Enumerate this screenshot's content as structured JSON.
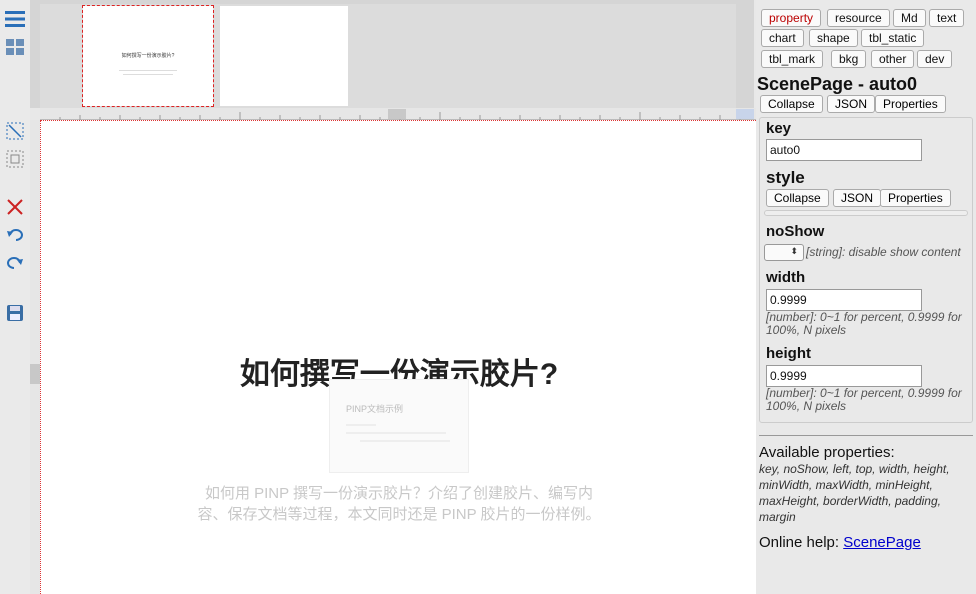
{
  "app": {
    "tabs": [
      "property",
      "resource",
      "Md",
      "text",
      "chart",
      "shape",
      "tbl_static",
      "tbl_mark",
      "bkg",
      "other",
      "dev"
    ]
  },
  "slide": {
    "title": "如何撰写一份演示胶片?",
    "description": "如何用 PINP 撰写一份演示胶片？介绍了创建胶片、编写内容、保存文档等过程，本文同时还是 PINP 胶片的一份样例。",
    "image_caption": "PINP文档示例",
    "thumb_title": "如何撰写一份演示胶片?"
  },
  "panel": {
    "title": "ScenePage - auto0",
    "collapse_label": "Collapse",
    "json_label": "JSON",
    "properties_label": "Properties",
    "key": {
      "label": "key",
      "value": "auto0"
    },
    "style": {
      "label": "style",
      "collapse_label": "Collapse",
      "json_label": "JSON",
      "properties_label": "Properties"
    },
    "noShow": {
      "label": "noShow",
      "hint": "[string]: disable show content"
    },
    "width": {
      "label": "width",
      "value": "0.9999",
      "hint": "[number]: 0~1 for percent, 0.9999 for 100%, N pixels"
    },
    "height": {
      "label": "height",
      "value": "0.9999",
      "hint": "[number]: 0~1 for percent, 0.9999 for 100%, N pixels"
    },
    "available_title": "Available properties:",
    "available_list": "key, noShow, left, top, width, height, minWidth, maxWidth, minHeight, maxHeight, borderWidth, padding, margin",
    "help_prefix": "Online help: ",
    "help_link": "ScenePage"
  },
  "colors": {
    "accent": "#2a6fb8",
    "selection": "#dd2222",
    "danger": "#cc2222"
  }
}
